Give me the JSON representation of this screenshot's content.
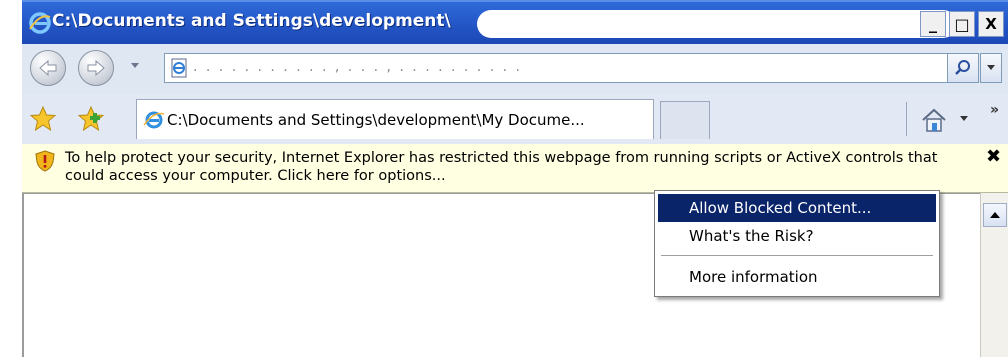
{
  "window": {
    "title": "C:\\Documents and Settings\\development\\",
    "buttons": {
      "minimize": "_",
      "maximize": "□",
      "close": "X"
    }
  },
  "address_bar": {
    "value": ". . . .    . . . . . . . , . . . , . . . . . . . . . ."
  },
  "tabs": [
    {
      "label": "C:\\Documents and Settings\\development\\My Docume..."
    }
  ],
  "info_bar": {
    "message": "To help protect your security, Internet Explorer has restricted this webpage from running scripts or ActiveX controls that could access your computer. Click here for options...",
    "close_glyph": "✖"
  },
  "context_menu": {
    "items": [
      {
        "label": "Allow Blocked Content...",
        "highlighted": true
      },
      {
        "label": "What's the Risk?",
        "highlighted": false
      },
      {
        "label": "More information",
        "highlighted": false
      }
    ]
  },
  "toolbar": {
    "overflow_glyph": "»"
  },
  "icons": {
    "title": "ie-logo-icon",
    "back": "back-arrow-icon",
    "forward": "forward-arrow-icon",
    "page": "page-icon",
    "search": "search-icon",
    "favorites": "favorites-star-icon",
    "add_favorite": "add-favorite-icon",
    "home": "home-icon",
    "shield": "shield-warning-icon"
  },
  "colors": {
    "titlebar": "#2558c9",
    "infobar": "#ffffe1",
    "menu_highlight": "#0a246a"
  }
}
